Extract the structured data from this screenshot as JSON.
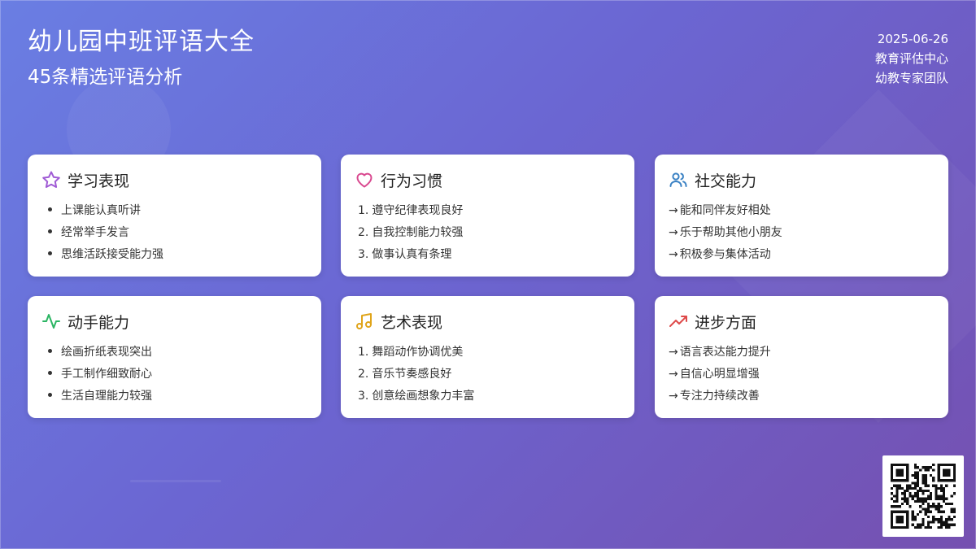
{
  "header": {
    "title": "幼儿园中班评语大全",
    "subtitle": "45条精选评语分析",
    "date": "2025-06-26",
    "org": "教育评估中心",
    "team": "幼教专家团队"
  },
  "cards": [
    {
      "title": "学习表现",
      "icon": "star-icon",
      "color": "#a05bd5",
      "style": "bullet",
      "items": [
        "上课能认真听讲",
        "经常举手发言",
        "思维活跃接受能力强"
      ]
    },
    {
      "title": "行为习惯",
      "icon": "heart-icon",
      "color": "#d9488f",
      "style": "number",
      "items": [
        "遵守纪律表现良好",
        "自我控制能力较强",
        "做事认真有条理"
      ]
    },
    {
      "title": "社交能力",
      "icon": "users-icon",
      "color": "#3b82c4",
      "style": "arrow",
      "items": [
        "能和同伴友好相处",
        "乐于帮助其他小朋友",
        "积极参与集体活动"
      ]
    },
    {
      "title": "动手能力",
      "icon": "activity-icon",
      "color": "#2bb563",
      "style": "bullet",
      "items": [
        "绘画折纸表现突出",
        "手工制作细致耐心",
        "生活自理能力较强"
      ]
    },
    {
      "title": "艺术表现",
      "icon": "music-icon",
      "color": "#e0a419",
      "style": "number",
      "items": [
        "舞蹈动作协调优美",
        "音乐节奏感良好",
        "创意绘画想象力丰富"
      ]
    },
    {
      "title": "进步方面",
      "icon": "trending-up-icon",
      "color": "#de4a4a",
      "style": "arrow",
      "items": [
        "语言表达能力提升",
        "自信心明显增强",
        "专注力持续改善"
      ]
    }
  ],
  "markers": {
    "arrow": "→"
  }
}
